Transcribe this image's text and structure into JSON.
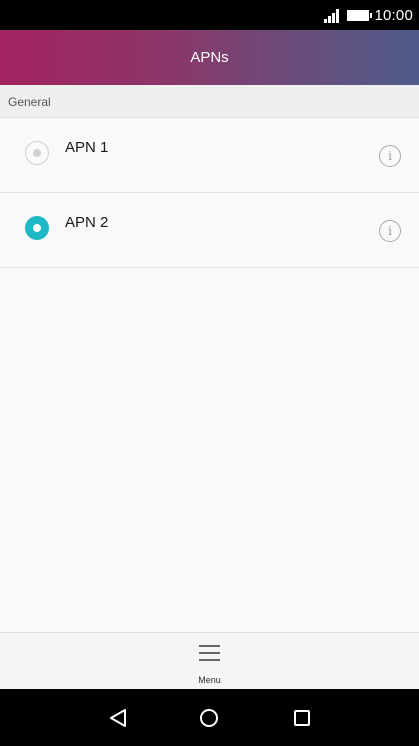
{
  "status_bar": {
    "time": "10:00",
    "icons": [
      "signal-icon",
      "battery-icon"
    ]
  },
  "app_bar": {
    "title": "APNs",
    "gradient_colors": [
      "#a3235f",
      "#4f5b8a"
    ]
  },
  "section": {
    "label": "General"
  },
  "apns": [
    {
      "name": "APN 1",
      "selected": false
    },
    {
      "name": "APN 2",
      "selected": true
    }
  ],
  "accent_color": "#1fb8c7",
  "bottom_bar": {
    "menu_label": "Menu"
  },
  "nav_bar": {
    "icons": [
      "back-icon",
      "home-icon",
      "recents-icon"
    ]
  }
}
